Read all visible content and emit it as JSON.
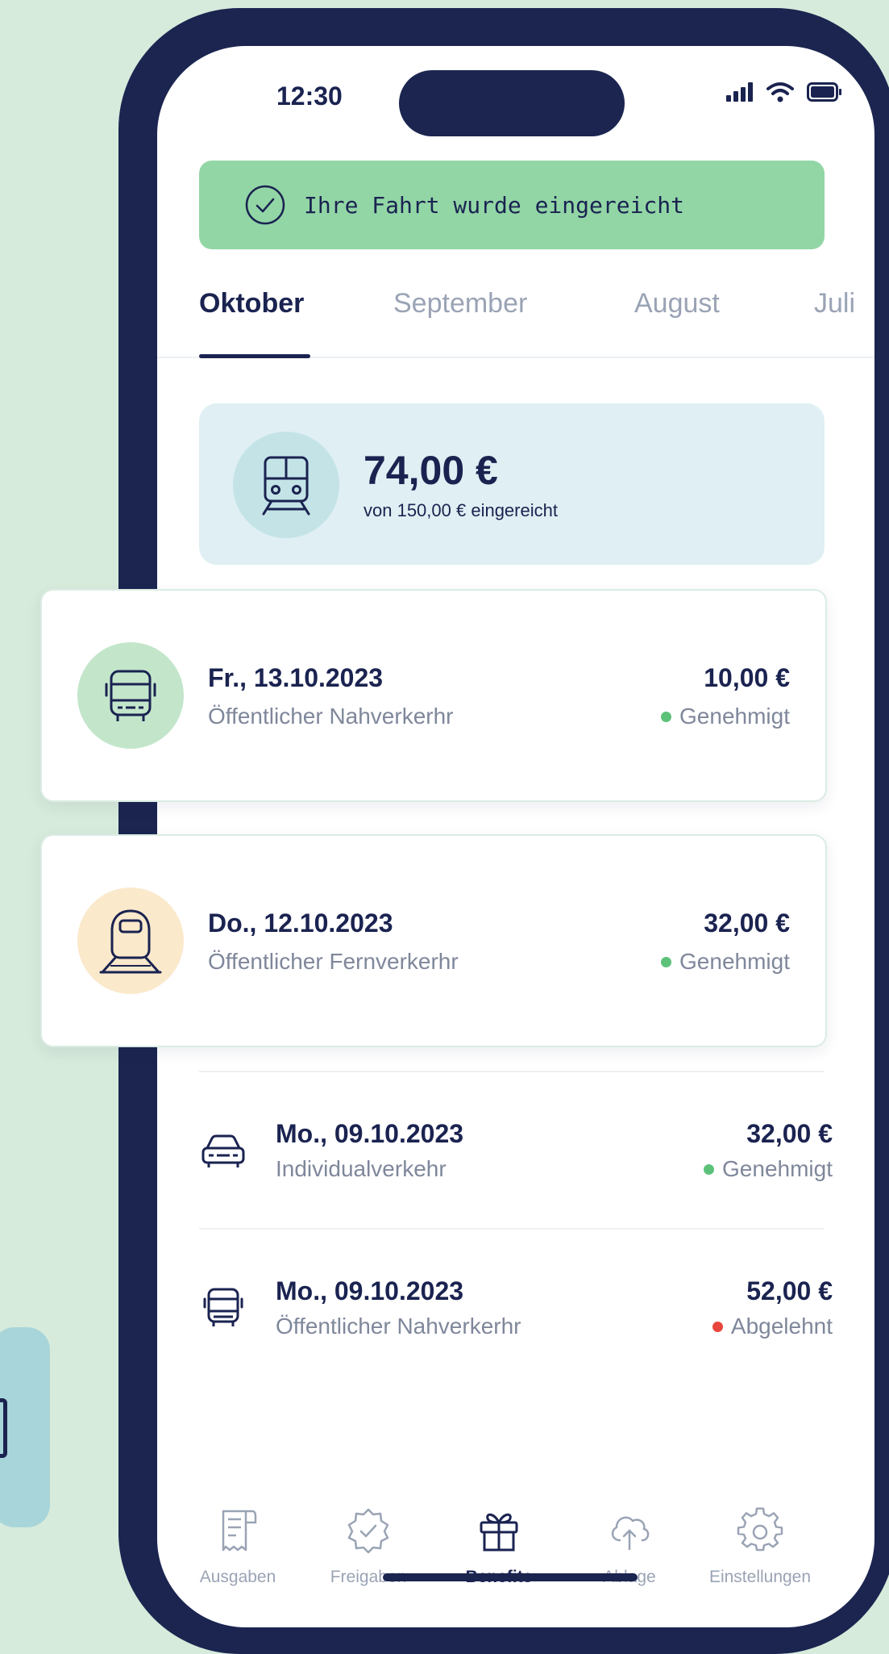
{
  "status_bar": {
    "time": "12:30"
  },
  "toast": {
    "text": "Ihre Fahrt wurde eingereicht",
    "icon": "check-circle-icon"
  },
  "tabs": [
    {
      "label": "Oktober",
      "active": true
    },
    {
      "label": "September",
      "active": false
    },
    {
      "label": "August",
      "active": false
    },
    {
      "label": "Juli",
      "active": false
    }
  ],
  "summary": {
    "amount": "74,00 €",
    "subtitle": "von 150,00 € eingereicht",
    "icon": "train-icon"
  },
  "cards": [
    {
      "date": "Fr., 13.10.2023",
      "type": "Öffentlicher Nahverkerhr",
      "amount": "10,00 €",
      "status": "Genehmigt",
      "status_color": "#5cc27a",
      "icon": "bus-icon",
      "icon_bg": "#c3e6cb"
    },
    {
      "date": "Do., 12.10.2023",
      "type": "Öffentlicher Fernverkerhr",
      "amount": "32,00 €",
      "status": "Genehmigt",
      "status_color": "#5cc27a",
      "icon": "high-speed-train-icon",
      "icon_bg": "#fbe9cc"
    }
  ],
  "rows": [
    {
      "date": "Mo., 09.10.2023",
      "type": "Individualverkehr",
      "amount": "32,00 €",
      "status": "Genehmigt",
      "status_color": "#5cc27a",
      "icon": "car-icon"
    },
    {
      "date": "Mo., 09.10.2023",
      "type": "Öffentlicher Nahverkerhr",
      "amount": "52,00 €",
      "status": "Abgelehnt",
      "status_color": "#e8453c",
      "icon": "bus-icon"
    }
  ],
  "nav": [
    {
      "label": "Ausgaben",
      "icon": "receipt-icon",
      "active": false
    },
    {
      "label": "Freigaben",
      "icon": "badge-check-icon",
      "active": false
    },
    {
      "label": "Benefits",
      "icon": "gift-icon",
      "active": true
    },
    {
      "label": "Ablage",
      "icon": "cloud-upload-icon",
      "active": false
    },
    {
      "label": "Einstellungen",
      "icon": "gear-icon",
      "active": false
    }
  ],
  "colors": {
    "navy": "#1b2550",
    "toast_green": "#92d6a6",
    "summary_bg": "#dfeff3",
    "background": "#d7ebdc"
  }
}
